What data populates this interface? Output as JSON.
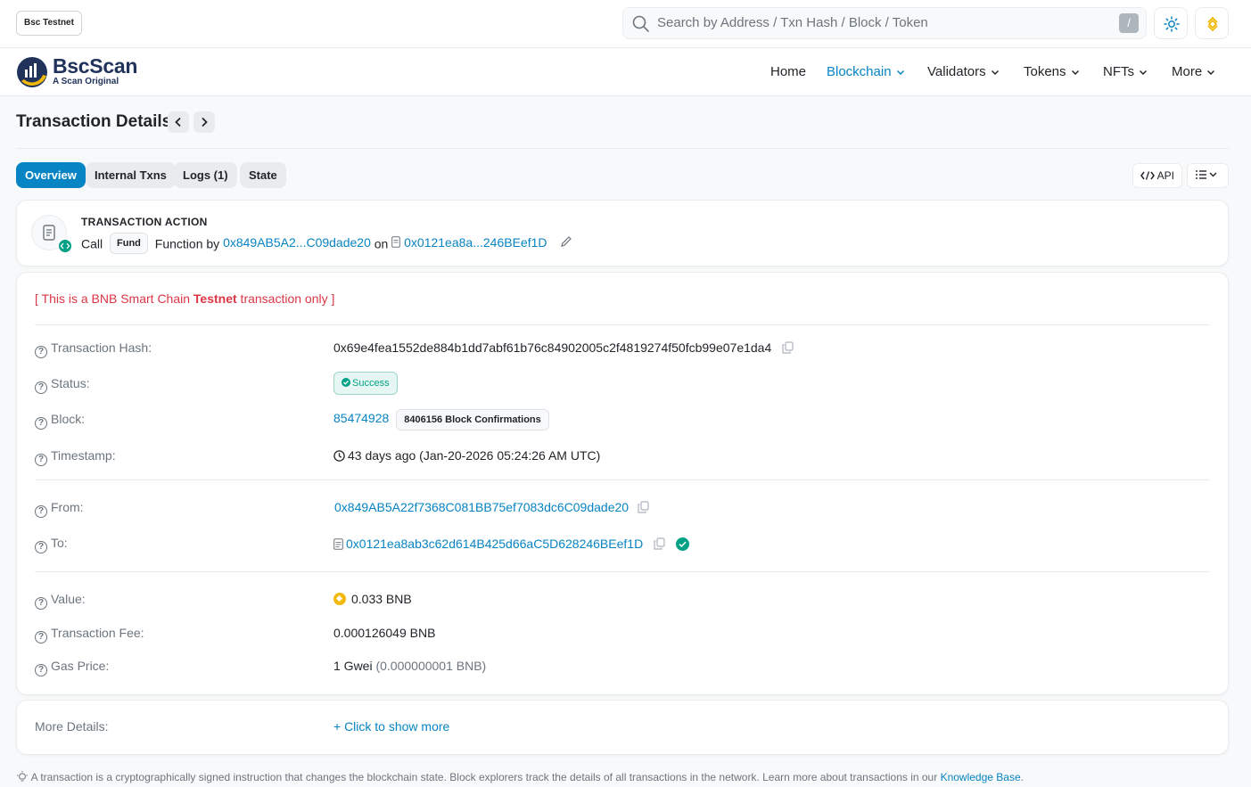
{
  "topbar": {
    "network_badge": "Bsc Testnet",
    "search_placeholder": "Search by Address / Txn Hash / Block / Token",
    "search_shortcut": "/"
  },
  "brand": {
    "name": "BscScan",
    "tagline": "A Scan Original"
  },
  "nav": {
    "items": [
      {
        "label": "Home",
        "dropdown": false,
        "active": false
      },
      {
        "label": "Blockchain",
        "dropdown": true,
        "active": true
      },
      {
        "label": "Validators",
        "dropdown": true,
        "active": false
      },
      {
        "label": "Tokens",
        "dropdown": true,
        "active": false
      },
      {
        "label": "NFTs",
        "dropdown": true,
        "active": false
      },
      {
        "label": "More",
        "dropdown": true,
        "active": false
      }
    ]
  },
  "page": {
    "title": "Transaction Details"
  },
  "tabs": [
    {
      "label": "Overview",
      "active": true
    },
    {
      "label": "Internal Txns",
      "active": false
    },
    {
      "label": "Logs (1)",
      "active": false
    },
    {
      "label": "State",
      "active": false
    }
  ],
  "tools": {
    "api_label": "API"
  },
  "action": {
    "heading": "TRANSACTION ACTION",
    "call": "Call",
    "method": "Fund",
    "function_by": "Function by",
    "from_short": "0x849AB5A2...C09dade20",
    "on": "on",
    "to_short": "0x0121ea8a...246BEef1D"
  },
  "notice": {
    "prefix": "[ This is a BNB Smart Chain ",
    "emphasis": "Testnet",
    "suffix": " transaction only ]"
  },
  "details": {
    "hash_label": "Transaction Hash:",
    "hash": "0x69e4fea1552de884b1dd7abf61b76c84902005c2f4819274f50fcb99e07e1da4",
    "status_label": "Status:",
    "status": "Success",
    "block_label": "Block:",
    "block": "85474928",
    "confirmations": "8406156 Block Confirmations",
    "timestamp_label": "Timestamp:",
    "timestamp": "43 days ago (Jan-20-2026 05:24:26 AM UTC)",
    "from_label": "From:",
    "from": "0x849AB5A22f7368C081BB75ef7083dc6C09dade20",
    "to_label": "To:",
    "to": "0x0121ea8ab3c62d614B425d66aC5D628246BEef1D",
    "value_label": "Value:",
    "value": "0.033 BNB",
    "fee_label": "Transaction Fee:",
    "fee": "0.000126049 BNB",
    "gas_label": "Gas Price:",
    "gas_price": "1 Gwei",
    "gas_price_bnb": "(0.000000001 BNB)"
  },
  "more": {
    "label": "More Details:",
    "link": "+ Click to show more"
  },
  "footer": {
    "text": "A transaction is a cryptographically signed instruction that changes the blockchain state. Block explorers track the details of all transactions in the network. Learn more about transactions in our ",
    "link": "Knowledge Base",
    "end": "."
  },
  "colors": {
    "accent": "#0784c3",
    "success": "#00a186",
    "danger": "#dc3545",
    "bnb": "#f0b90b"
  }
}
